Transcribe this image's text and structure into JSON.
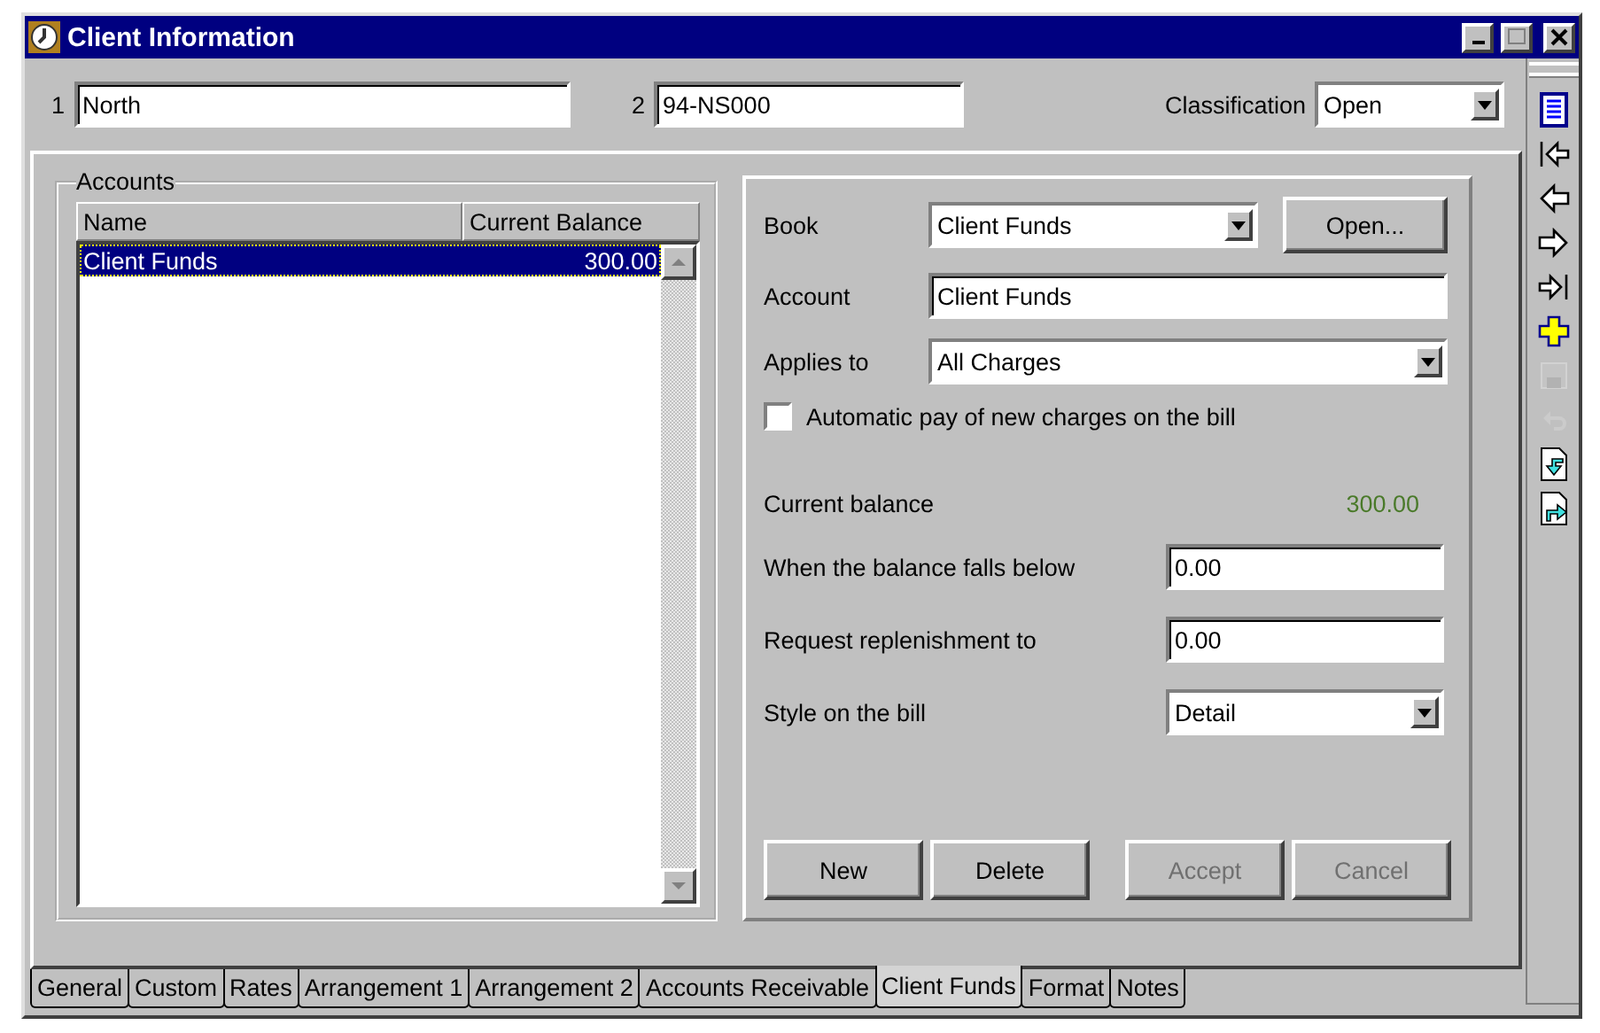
{
  "window": {
    "title": "Client Information"
  },
  "header": {
    "fields": [
      {
        "label": "1",
        "value": "North"
      },
      {
        "label": "2",
        "value": "94-NS000"
      }
    ],
    "classification": {
      "label": "Classification",
      "value": "Open"
    }
  },
  "accounts": {
    "title": "Accounts",
    "columns": [
      "Name",
      "Current Balance"
    ],
    "rows": [
      {
        "name": "Client Funds",
        "balance": "300.00",
        "selected": true
      }
    ]
  },
  "detail": {
    "book": {
      "label": "Book",
      "value": "Client Funds",
      "button": "Open..."
    },
    "account": {
      "label": "Account",
      "value": "Client Funds"
    },
    "applies_to": {
      "label": "Applies to",
      "value": "All Charges"
    },
    "auto_pay": {
      "label": "Automatic pay of new charges on the bill",
      "checked": false
    },
    "current_balance": {
      "label": "Current balance",
      "value": "300.00"
    },
    "fields": [
      {
        "kind": "input",
        "label": "When the balance falls below",
        "value": "0.00"
      },
      {
        "kind": "input",
        "label": "Request replenishment to",
        "value": "0.00"
      },
      {
        "kind": "dropdown",
        "label": "Style on the bill",
        "value": "Detail"
      }
    ],
    "buttons": [
      {
        "label": "New",
        "disabled": false
      },
      {
        "label": "Delete",
        "disabled": false
      },
      {
        "label": "Accept",
        "disabled": true
      },
      {
        "label": "Cancel",
        "disabled": true
      }
    ]
  },
  "toolbar": [
    {
      "kind": "list",
      "disabled": false
    },
    {
      "kind": "first",
      "disabled": false
    },
    {
      "kind": "prev",
      "disabled": false
    },
    {
      "kind": "next",
      "disabled": false
    },
    {
      "kind": "last",
      "disabled": false
    },
    {
      "kind": "add",
      "disabled": false
    },
    {
      "kind": "save",
      "disabled": true
    },
    {
      "kind": "undo",
      "disabled": true
    },
    {
      "kind": "import",
      "disabled": false
    },
    {
      "kind": "export",
      "disabled": false
    }
  ],
  "tabs": [
    {
      "label": "General",
      "selected": false
    },
    {
      "label": "Custom",
      "selected": false
    },
    {
      "label": "Rates",
      "selected": false
    },
    {
      "label": "Arrangement 1",
      "selected": false
    },
    {
      "label": "Arrangement 2",
      "selected": false
    },
    {
      "label": "Accounts Receivable",
      "selected": false
    },
    {
      "label": "Client Funds",
      "selected": true
    },
    {
      "label": "Format",
      "selected": false
    },
    {
      "label": "Notes",
      "selected": false
    }
  ]
}
